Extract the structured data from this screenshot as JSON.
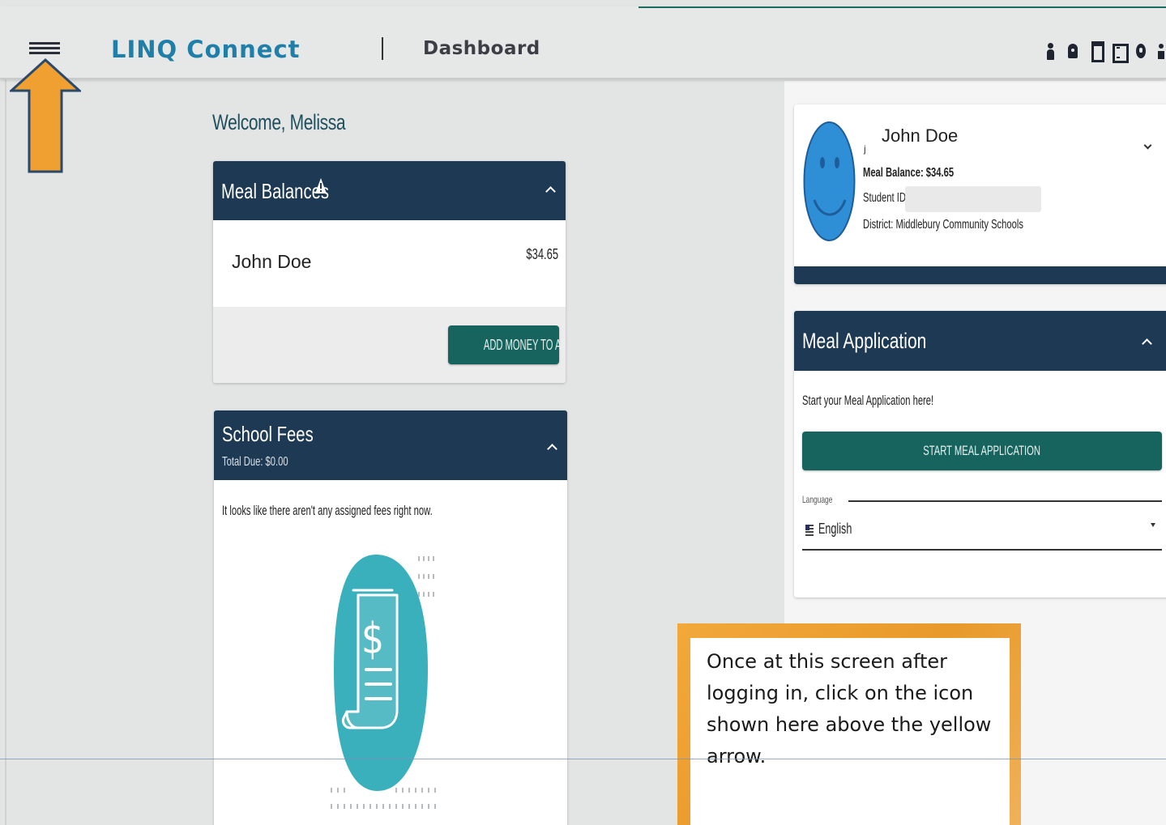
{
  "header": {
    "brand": "LINQ Connect",
    "page_title": "Dashboard",
    "menu_icon": "hamburger-menu-icon",
    "icons": [
      "person-icon",
      "bell-icon",
      "cart-icon",
      "grid-icon",
      "help-icon",
      "account-icon"
    ]
  },
  "welcome": "Welcome, Melissa",
  "meal_balances": {
    "title": "Meal Balances",
    "warning_icon": "warning-icon",
    "student_name": "John Doe",
    "amount": "$34.65",
    "add_button": "ADD MONEY TO ACCOUNT"
  },
  "school_fees": {
    "title": "School Fees",
    "total_due": "Total Due: $0.00",
    "empty_message": "It looks like there aren't any assigned fees right now.",
    "illustration_icon": "receipt-dollar-icon"
  },
  "student_card": {
    "initial": "j",
    "name": "John Doe",
    "meal_balance": "Meal Balance: $34.65",
    "student_id_label": "Student ID",
    "district": "District: Middlebury Community Schools",
    "avatar_icon": "smiley-face-icon"
  },
  "meal_application": {
    "title": "Meal Application",
    "prompt": "Start your Meal Application here!",
    "start_button": "START MEAL APPLICATION",
    "language_label": "Language",
    "language_value": "English",
    "flag_icon": "us-flag-icon"
  },
  "callout": {
    "text": "Once at this screen after logging in, click on the icon shown here above the yellow arrow."
  },
  "colors": {
    "brand": "#1f7fa8",
    "header_navy": "#1d3954",
    "button_teal": "#17645e",
    "arrow_orange": "#f0a030",
    "avatar_blue": "#2e8fd6"
  }
}
